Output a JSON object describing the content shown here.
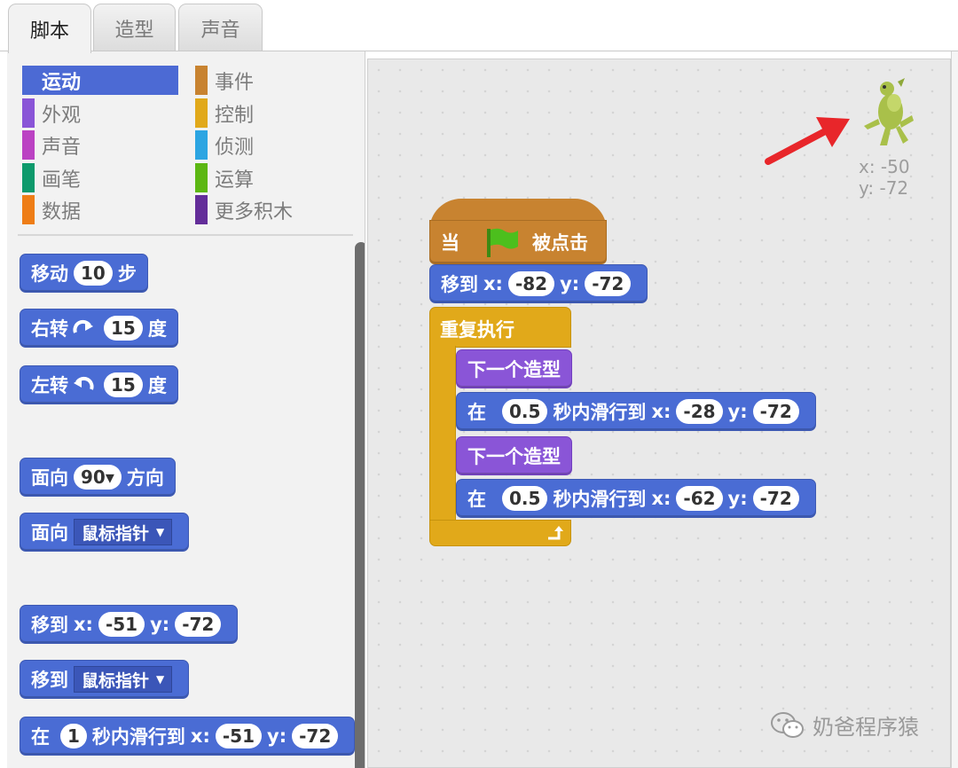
{
  "tabs": [
    "脚本",
    "造型",
    "声音"
  ],
  "categories_left": [
    {
      "label": "运动",
      "color": "#4a6cd4"
    },
    {
      "label": "外观",
      "color": "#8a55d7"
    },
    {
      "label": "声音",
      "color": "#bb42c3"
    },
    {
      "label": "画笔",
      "color": "#0e9a6c"
    },
    {
      "label": "数据",
      "color": "#ee7d16"
    }
  ],
  "categories_right": [
    {
      "label": "事件",
      "color": "#c88330"
    },
    {
      "label": "控制",
      "color": "#e1a91a"
    },
    {
      "label": "侦测",
      "color": "#2ca5e2"
    },
    {
      "label": "运算",
      "color": "#5cb712"
    },
    {
      "label": "更多积木",
      "color": "#632d99"
    }
  ],
  "palette": {
    "move": {
      "a": "移动",
      "v": "10",
      "b": "步"
    },
    "turn_right": {
      "a": "右转",
      "v": "15",
      "b": "度"
    },
    "turn_left": {
      "a": "左转",
      "v": "15",
      "b": "度"
    },
    "point_dir": {
      "a": "面向",
      "v": "90▾",
      "b": "方向"
    },
    "point_to": {
      "a": "面向",
      "d": "鼠标指针"
    },
    "goto_xy": {
      "a": "移到",
      "xl": "x:",
      "x": "-51",
      "yl": "y:",
      "y": "-72"
    },
    "goto_to": {
      "a": "移到",
      "d": "鼠标指针"
    },
    "glide": {
      "a": "在",
      "v": "1",
      "b": "秒内滑行到",
      "xl": "x:",
      "x": "-51",
      "yl": "y:",
      "y": "-72"
    }
  },
  "script": {
    "hat": {
      "a": "当",
      "b": "被点击"
    },
    "goto": {
      "a": "移到",
      "xl": "x:",
      "x": "-82",
      "yl": "y:",
      "y": "-72"
    },
    "forever": "重复执行",
    "next1": "下一个造型",
    "glide1": {
      "a": "在",
      "v": "0.5",
      "b": "秒内滑行到",
      "xl": "x:",
      "x": "-28",
      "yl": "y:",
      "y": "-72"
    },
    "next2": "下一个造型",
    "glide2": {
      "a": "在",
      "v": "0.5",
      "b": "秒内滑行到",
      "xl": "x:",
      "x": "-62",
      "yl": "y:",
      "y": "-72"
    }
  },
  "sprite_info": {
    "x": "x: -50",
    "y": "y: -72"
  },
  "watermark": "奶爸程序猿",
  "colors": {
    "motion": "#4a6cd4",
    "looks": "#8a55d7",
    "control": "#e1a91a",
    "events": "#c88330",
    "arrow": "#e8262a"
  }
}
